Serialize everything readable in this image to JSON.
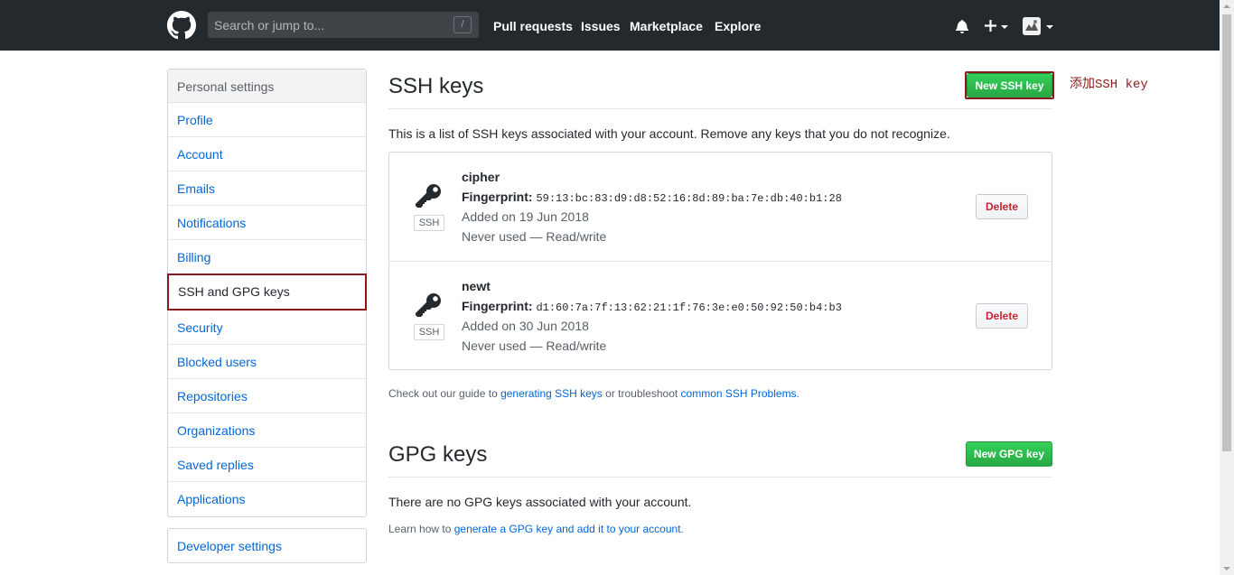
{
  "header": {
    "search_placeholder": "Search or jump to...",
    "search_shortcut": "/",
    "nav": [
      "Pull requests",
      "Issues",
      "Marketplace",
      "Explore"
    ]
  },
  "sidebar": {
    "heading": "Personal settings",
    "items": [
      {
        "label": "Profile"
      },
      {
        "label": "Account"
      },
      {
        "label": "Emails"
      },
      {
        "label": "Notifications"
      },
      {
        "label": "Billing"
      },
      {
        "label": "SSH and GPG keys",
        "selected": true
      },
      {
        "label": "Security"
      },
      {
        "label": "Blocked users"
      },
      {
        "label": "Repositories"
      },
      {
        "label": "Organizations"
      },
      {
        "label": "Saved replies"
      },
      {
        "label": "Applications"
      }
    ],
    "developer_settings": "Developer settings"
  },
  "ssh": {
    "title": "SSH keys",
    "new_button": "New SSH key",
    "annotation": "添加SSH key",
    "description": "This is a list of SSH keys associated with your account. Remove any keys that you do not recognize.",
    "keys": [
      {
        "name": "cipher",
        "label": "SSH",
        "fingerprint_label": "Fingerprint:",
        "fingerprint": "59:13:bc:83:d9:d8:52:16:8d:89:ba:7e:db:40:b1:28",
        "added": "Added on 19 Jun 2018",
        "usage": "Never used — Read/write",
        "delete": "Delete"
      },
      {
        "name": "newt",
        "label": "SSH",
        "fingerprint_label": "Fingerprint:",
        "fingerprint": "d1:60:7a:7f:13:62:21:1f:76:3e:e0:50:92:50:b4:b3",
        "added": "Added on 30 Jun 2018",
        "usage": "Never used — Read/write",
        "delete": "Delete"
      }
    ],
    "guide": {
      "prefix": "Check out our guide to ",
      "link1": "generating SSH keys",
      "middle": " or troubleshoot ",
      "link2": "common SSH Problems",
      "suffix": "."
    }
  },
  "gpg": {
    "title": "GPG keys",
    "new_button": "New GPG key",
    "empty": "There are no GPG keys associated with your account.",
    "learn": {
      "prefix": "Learn how to ",
      "link": "generate a GPG key and add it to your account",
      "suffix": "."
    }
  },
  "colors": {
    "header_bg": "#24292e",
    "link": "#0366d6",
    "green": "#28a745",
    "delete_red": "#cb2431",
    "annotation": "#8b1a1a"
  }
}
